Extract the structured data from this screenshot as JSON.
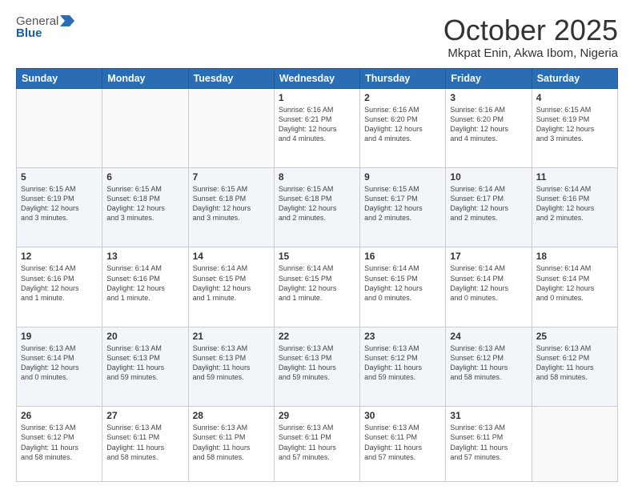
{
  "header": {
    "logo_general": "General",
    "logo_blue": "Blue",
    "month": "October 2025",
    "location": "Mkpat Enin, Akwa Ibom, Nigeria"
  },
  "days_of_week": [
    "Sunday",
    "Monday",
    "Tuesday",
    "Wednesday",
    "Thursday",
    "Friday",
    "Saturday"
  ],
  "weeks": [
    [
      {
        "day": "",
        "info": ""
      },
      {
        "day": "",
        "info": ""
      },
      {
        "day": "",
        "info": ""
      },
      {
        "day": "1",
        "info": "Sunrise: 6:16 AM\nSunset: 6:21 PM\nDaylight: 12 hours\nand 4 minutes."
      },
      {
        "day": "2",
        "info": "Sunrise: 6:16 AM\nSunset: 6:20 PM\nDaylight: 12 hours\nand 4 minutes."
      },
      {
        "day": "3",
        "info": "Sunrise: 6:16 AM\nSunset: 6:20 PM\nDaylight: 12 hours\nand 4 minutes."
      },
      {
        "day": "4",
        "info": "Sunrise: 6:15 AM\nSunset: 6:19 PM\nDaylight: 12 hours\nand 3 minutes."
      }
    ],
    [
      {
        "day": "5",
        "info": "Sunrise: 6:15 AM\nSunset: 6:19 PM\nDaylight: 12 hours\nand 3 minutes."
      },
      {
        "day": "6",
        "info": "Sunrise: 6:15 AM\nSunset: 6:18 PM\nDaylight: 12 hours\nand 3 minutes."
      },
      {
        "day": "7",
        "info": "Sunrise: 6:15 AM\nSunset: 6:18 PM\nDaylight: 12 hours\nand 3 minutes."
      },
      {
        "day": "8",
        "info": "Sunrise: 6:15 AM\nSunset: 6:18 PM\nDaylight: 12 hours\nand 2 minutes."
      },
      {
        "day": "9",
        "info": "Sunrise: 6:15 AM\nSunset: 6:17 PM\nDaylight: 12 hours\nand 2 minutes."
      },
      {
        "day": "10",
        "info": "Sunrise: 6:14 AM\nSunset: 6:17 PM\nDaylight: 12 hours\nand 2 minutes."
      },
      {
        "day": "11",
        "info": "Sunrise: 6:14 AM\nSunset: 6:16 PM\nDaylight: 12 hours\nand 2 minutes."
      }
    ],
    [
      {
        "day": "12",
        "info": "Sunrise: 6:14 AM\nSunset: 6:16 PM\nDaylight: 12 hours\nand 1 minute."
      },
      {
        "day": "13",
        "info": "Sunrise: 6:14 AM\nSunset: 6:16 PM\nDaylight: 12 hours\nand 1 minute."
      },
      {
        "day": "14",
        "info": "Sunrise: 6:14 AM\nSunset: 6:15 PM\nDaylight: 12 hours\nand 1 minute."
      },
      {
        "day": "15",
        "info": "Sunrise: 6:14 AM\nSunset: 6:15 PM\nDaylight: 12 hours\nand 1 minute."
      },
      {
        "day": "16",
        "info": "Sunrise: 6:14 AM\nSunset: 6:15 PM\nDaylight: 12 hours\nand 0 minutes."
      },
      {
        "day": "17",
        "info": "Sunrise: 6:14 AM\nSunset: 6:14 PM\nDaylight: 12 hours\nand 0 minutes."
      },
      {
        "day": "18",
        "info": "Sunrise: 6:14 AM\nSunset: 6:14 PM\nDaylight: 12 hours\nand 0 minutes."
      }
    ],
    [
      {
        "day": "19",
        "info": "Sunrise: 6:13 AM\nSunset: 6:14 PM\nDaylight: 12 hours\nand 0 minutes."
      },
      {
        "day": "20",
        "info": "Sunrise: 6:13 AM\nSunset: 6:13 PM\nDaylight: 11 hours\nand 59 minutes."
      },
      {
        "day": "21",
        "info": "Sunrise: 6:13 AM\nSunset: 6:13 PM\nDaylight: 11 hours\nand 59 minutes."
      },
      {
        "day": "22",
        "info": "Sunrise: 6:13 AM\nSunset: 6:13 PM\nDaylight: 11 hours\nand 59 minutes."
      },
      {
        "day": "23",
        "info": "Sunrise: 6:13 AM\nSunset: 6:12 PM\nDaylight: 11 hours\nand 59 minutes."
      },
      {
        "day": "24",
        "info": "Sunrise: 6:13 AM\nSunset: 6:12 PM\nDaylight: 11 hours\nand 58 minutes."
      },
      {
        "day": "25",
        "info": "Sunrise: 6:13 AM\nSunset: 6:12 PM\nDaylight: 11 hours\nand 58 minutes."
      }
    ],
    [
      {
        "day": "26",
        "info": "Sunrise: 6:13 AM\nSunset: 6:12 PM\nDaylight: 11 hours\nand 58 minutes."
      },
      {
        "day": "27",
        "info": "Sunrise: 6:13 AM\nSunset: 6:11 PM\nDaylight: 11 hours\nand 58 minutes."
      },
      {
        "day": "28",
        "info": "Sunrise: 6:13 AM\nSunset: 6:11 PM\nDaylight: 11 hours\nand 58 minutes."
      },
      {
        "day": "29",
        "info": "Sunrise: 6:13 AM\nSunset: 6:11 PM\nDaylight: 11 hours\nand 57 minutes."
      },
      {
        "day": "30",
        "info": "Sunrise: 6:13 AM\nSunset: 6:11 PM\nDaylight: 11 hours\nand 57 minutes."
      },
      {
        "day": "31",
        "info": "Sunrise: 6:13 AM\nSunset: 6:11 PM\nDaylight: 11 hours\nand 57 minutes."
      },
      {
        "day": "",
        "info": ""
      }
    ]
  ]
}
